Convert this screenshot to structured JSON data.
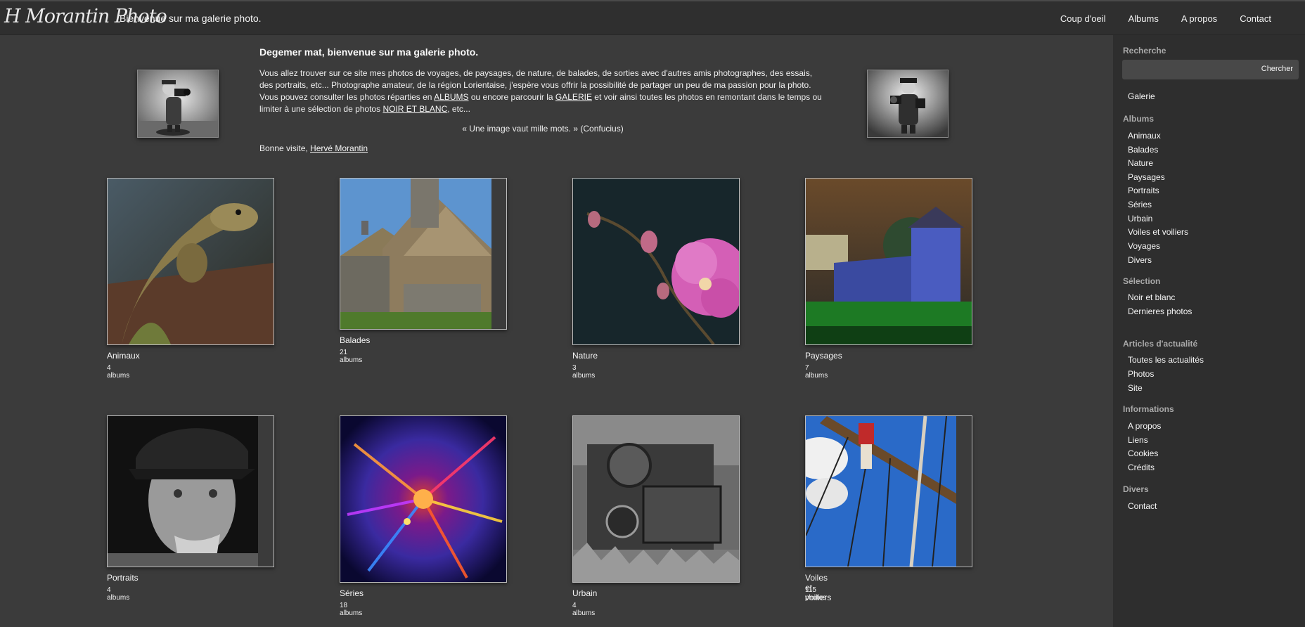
{
  "header": {
    "logo": "H Morantin Photo",
    "tagline": "Bienvenue sur ma galerie photo.",
    "nav": [
      "Coup d'oeil",
      "Albums",
      "A propos",
      "Contact"
    ]
  },
  "intro": {
    "title": "Degemer mat, bienvenue sur ma galerie photo.",
    "text_before_albums": "Vous allez trouver sur ce site mes photos de voyages, de paysages, de nature, de balades, de sorties avec d'autres amis photographes, des essais, des portraits, etc... Photographe amateur, de la région Lorientaise, j'espère vous offrir la possibilité de partager un peu de ma passion pour la photo. Vous pouvez consulter les photos réparties en ",
    "link_albums": "ALBUMS",
    "text_middle": " ou encore parcourir la ",
    "link_galerie": "GALERIE",
    "text_after_galerie": " et voir ainsi toutes les photos en remontant dans le temps ou limiter à une sélection de photos ",
    "link_noir_blanc": "NOIR ET BLANC",
    "text_end": ", etc...",
    "quote": "« Une image vaut mille mots. » (Confucius)",
    "signoff_prefix": "Bonne visite, ",
    "signoff_link": "Hervé Morantin"
  },
  "albums": [
    {
      "name": "Animaux",
      "count": "4 albums"
    },
    {
      "name": "Balades",
      "count": "21 albums"
    },
    {
      "name": "Nature",
      "count": "3 albums"
    },
    {
      "name": "Paysages",
      "count": "7 albums"
    },
    {
      "name": "Portraits",
      "count": "4 albums"
    },
    {
      "name": "Séries",
      "count": "18 albums"
    },
    {
      "name": "Urbain",
      "count": "4 albums"
    },
    {
      "name": "Voiles et voiliers",
      "count": "115 photos"
    }
  ],
  "sidebar": {
    "search_heading": "Recherche",
    "search_button": "Chercher",
    "galerie": "Galerie",
    "albums_heading": "Albums",
    "albums": [
      "Animaux",
      "Balades",
      "Nature",
      "Paysages",
      "Portraits",
      "Séries",
      "Urbain",
      "Voiles et voiliers",
      "Voyages",
      "Divers"
    ],
    "selection_heading": "Sélection",
    "selection": [
      "Noir et blanc",
      "Dernieres photos"
    ],
    "articles_heading": "Articles d'actualité",
    "articles": [
      "Toutes les actualités",
      "Photos",
      "Site"
    ],
    "info_heading": "Informations",
    "info": [
      "A propos",
      "Liens",
      "Cookies",
      "Crédits"
    ],
    "divers_heading": "Divers",
    "divers": [
      "Contact"
    ]
  }
}
